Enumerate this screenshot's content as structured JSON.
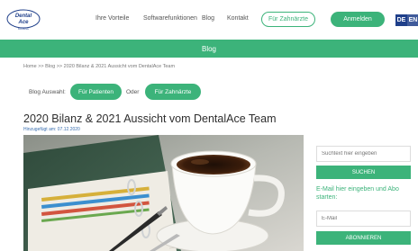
{
  "header": {
    "logo_line1": "Dental",
    "logo_line2": "Ace",
    "logo_line3": "BOOKING",
    "nav": [
      "Ihre Vorteile",
      "Softwarefunktionen",
      "Blog",
      "Kontakt"
    ],
    "for_dentists": "Für Zahnärzte",
    "accent_btn": "Anmelden",
    "lang_de": "DE",
    "lang_en": "EN"
  },
  "banner": {
    "title": "Blog"
  },
  "breadcrumb": {
    "home": "Home",
    "sep": " >> ",
    "blog": "Blog",
    "current": "2020 Bilanz & 2021 Aussicht vom DentalAce Team"
  },
  "filter": {
    "label": "Blog Auswahl:",
    "patients": "Für Patienten",
    "or": "Oder",
    "dentists": "Für Zahnärzte"
  },
  "post": {
    "title": "2020 Bilanz & 2021 Aussicht vom DentalAce Team",
    "date": "Hinzugefügt am: 07.12.2020"
  },
  "sidebar": {
    "search_placeholder": "Suchtext hier eingeben",
    "search_button": "SUCHEN",
    "newsletter_text": "E-Mail hier eingeben und Abo starten:",
    "email_placeholder": "E-Mail",
    "subscribe_button": "ABONNIEREN"
  },
  "colors": {
    "accent": "#3cb37a",
    "lang": "#1f3f8a"
  }
}
